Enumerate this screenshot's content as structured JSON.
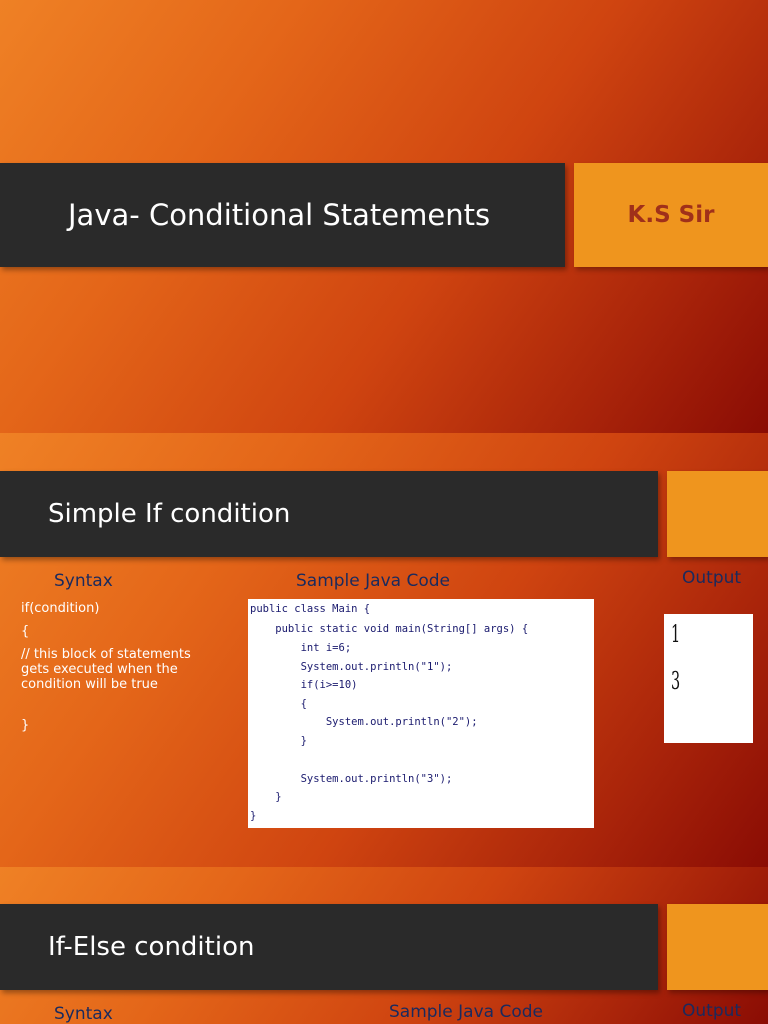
{
  "slide1": {
    "title": "Java- Conditional Statements",
    "author": "K.S Sir"
  },
  "slide2": {
    "title": "Simple If condition",
    "syntax_label": "Syntax",
    "code_label": "Sample Java Code",
    "output_label": "Output",
    "syntax_lines": [
      "if(condition)",
      "{",
      "// this block of statements",
      "gets executed when the",
      "condition will be true",
      "",
      "",
      "}"
    ],
    "code_lines": [
      "public class Main {",
      "    public static void main(String[] args) {",
      "        int i=6;",
      "        System.out.println(\"1\");",
      "        if(i>=10)",
      "        {",
      "            System.out.println(\"2\");",
      "        }",
      "",
      "        System.out.println(\"3\");",
      "    }",
      "}"
    ],
    "output_lines": [
      "1",
      "3"
    ]
  },
  "slide3": {
    "title": "If-Else condition",
    "syntax_label": "Syntax",
    "code_label": "Sample Java Code",
    "output_label": "Output"
  }
}
